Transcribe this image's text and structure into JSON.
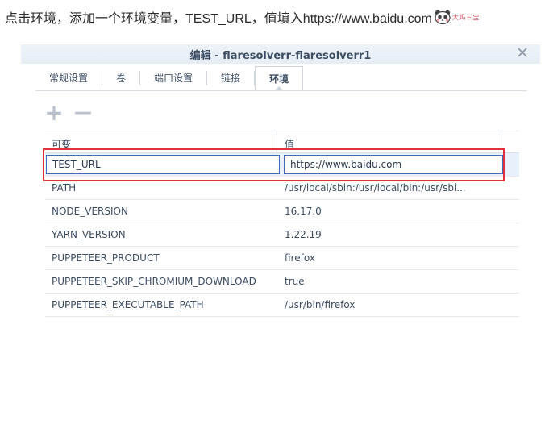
{
  "instruction": {
    "text": "点击环境，添加一个环境变量，TEST_URL，值填入https://www.baidu.com",
    "sticker_text": "大妈三宝"
  },
  "dialog": {
    "title": "编辑 - flaresolverr-flaresolverr1",
    "close_icon": "close-icon"
  },
  "tabs": [
    {
      "label": "常规设置",
      "active": false
    },
    {
      "label": "卷",
      "active": false
    },
    {
      "label": "端口设置",
      "active": false
    },
    {
      "label": "链接",
      "active": false
    },
    {
      "label": "环境",
      "active": true
    }
  ],
  "toolbar": {
    "add_glyph": "+",
    "remove_glyph": "—"
  },
  "grid": {
    "columns": [
      "可变",
      "值"
    ],
    "editing_row": {
      "key": "TEST_URL",
      "value": "https://www.baidu.com"
    },
    "rows": [
      {
        "key": "PATH",
        "value": "/usr/local/sbin:/usr/local/bin:/usr/sbi..."
      },
      {
        "key": "NODE_VERSION",
        "value": "16.17.0"
      },
      {
        "key": "YARN_VERSION",
        "value": "1.22.19"
      },
      {
        "key": "PUPPETEER_PRODUCT",
        "value": "firefox"
      },
      {
        "key": "PUPPETEER_SKIP_CHROMIUM_DOWNLOAD",
        "value": "true"
      },
      {
        "key": "PUPPETEER_EXECUTABLE_PATH",
        "value": "/usr/bin/firefox"
      }
    ]
  },
  "colors": {
    "highlight": "#e0323a",
    "accent": "#3a6fb7"
  }
}
